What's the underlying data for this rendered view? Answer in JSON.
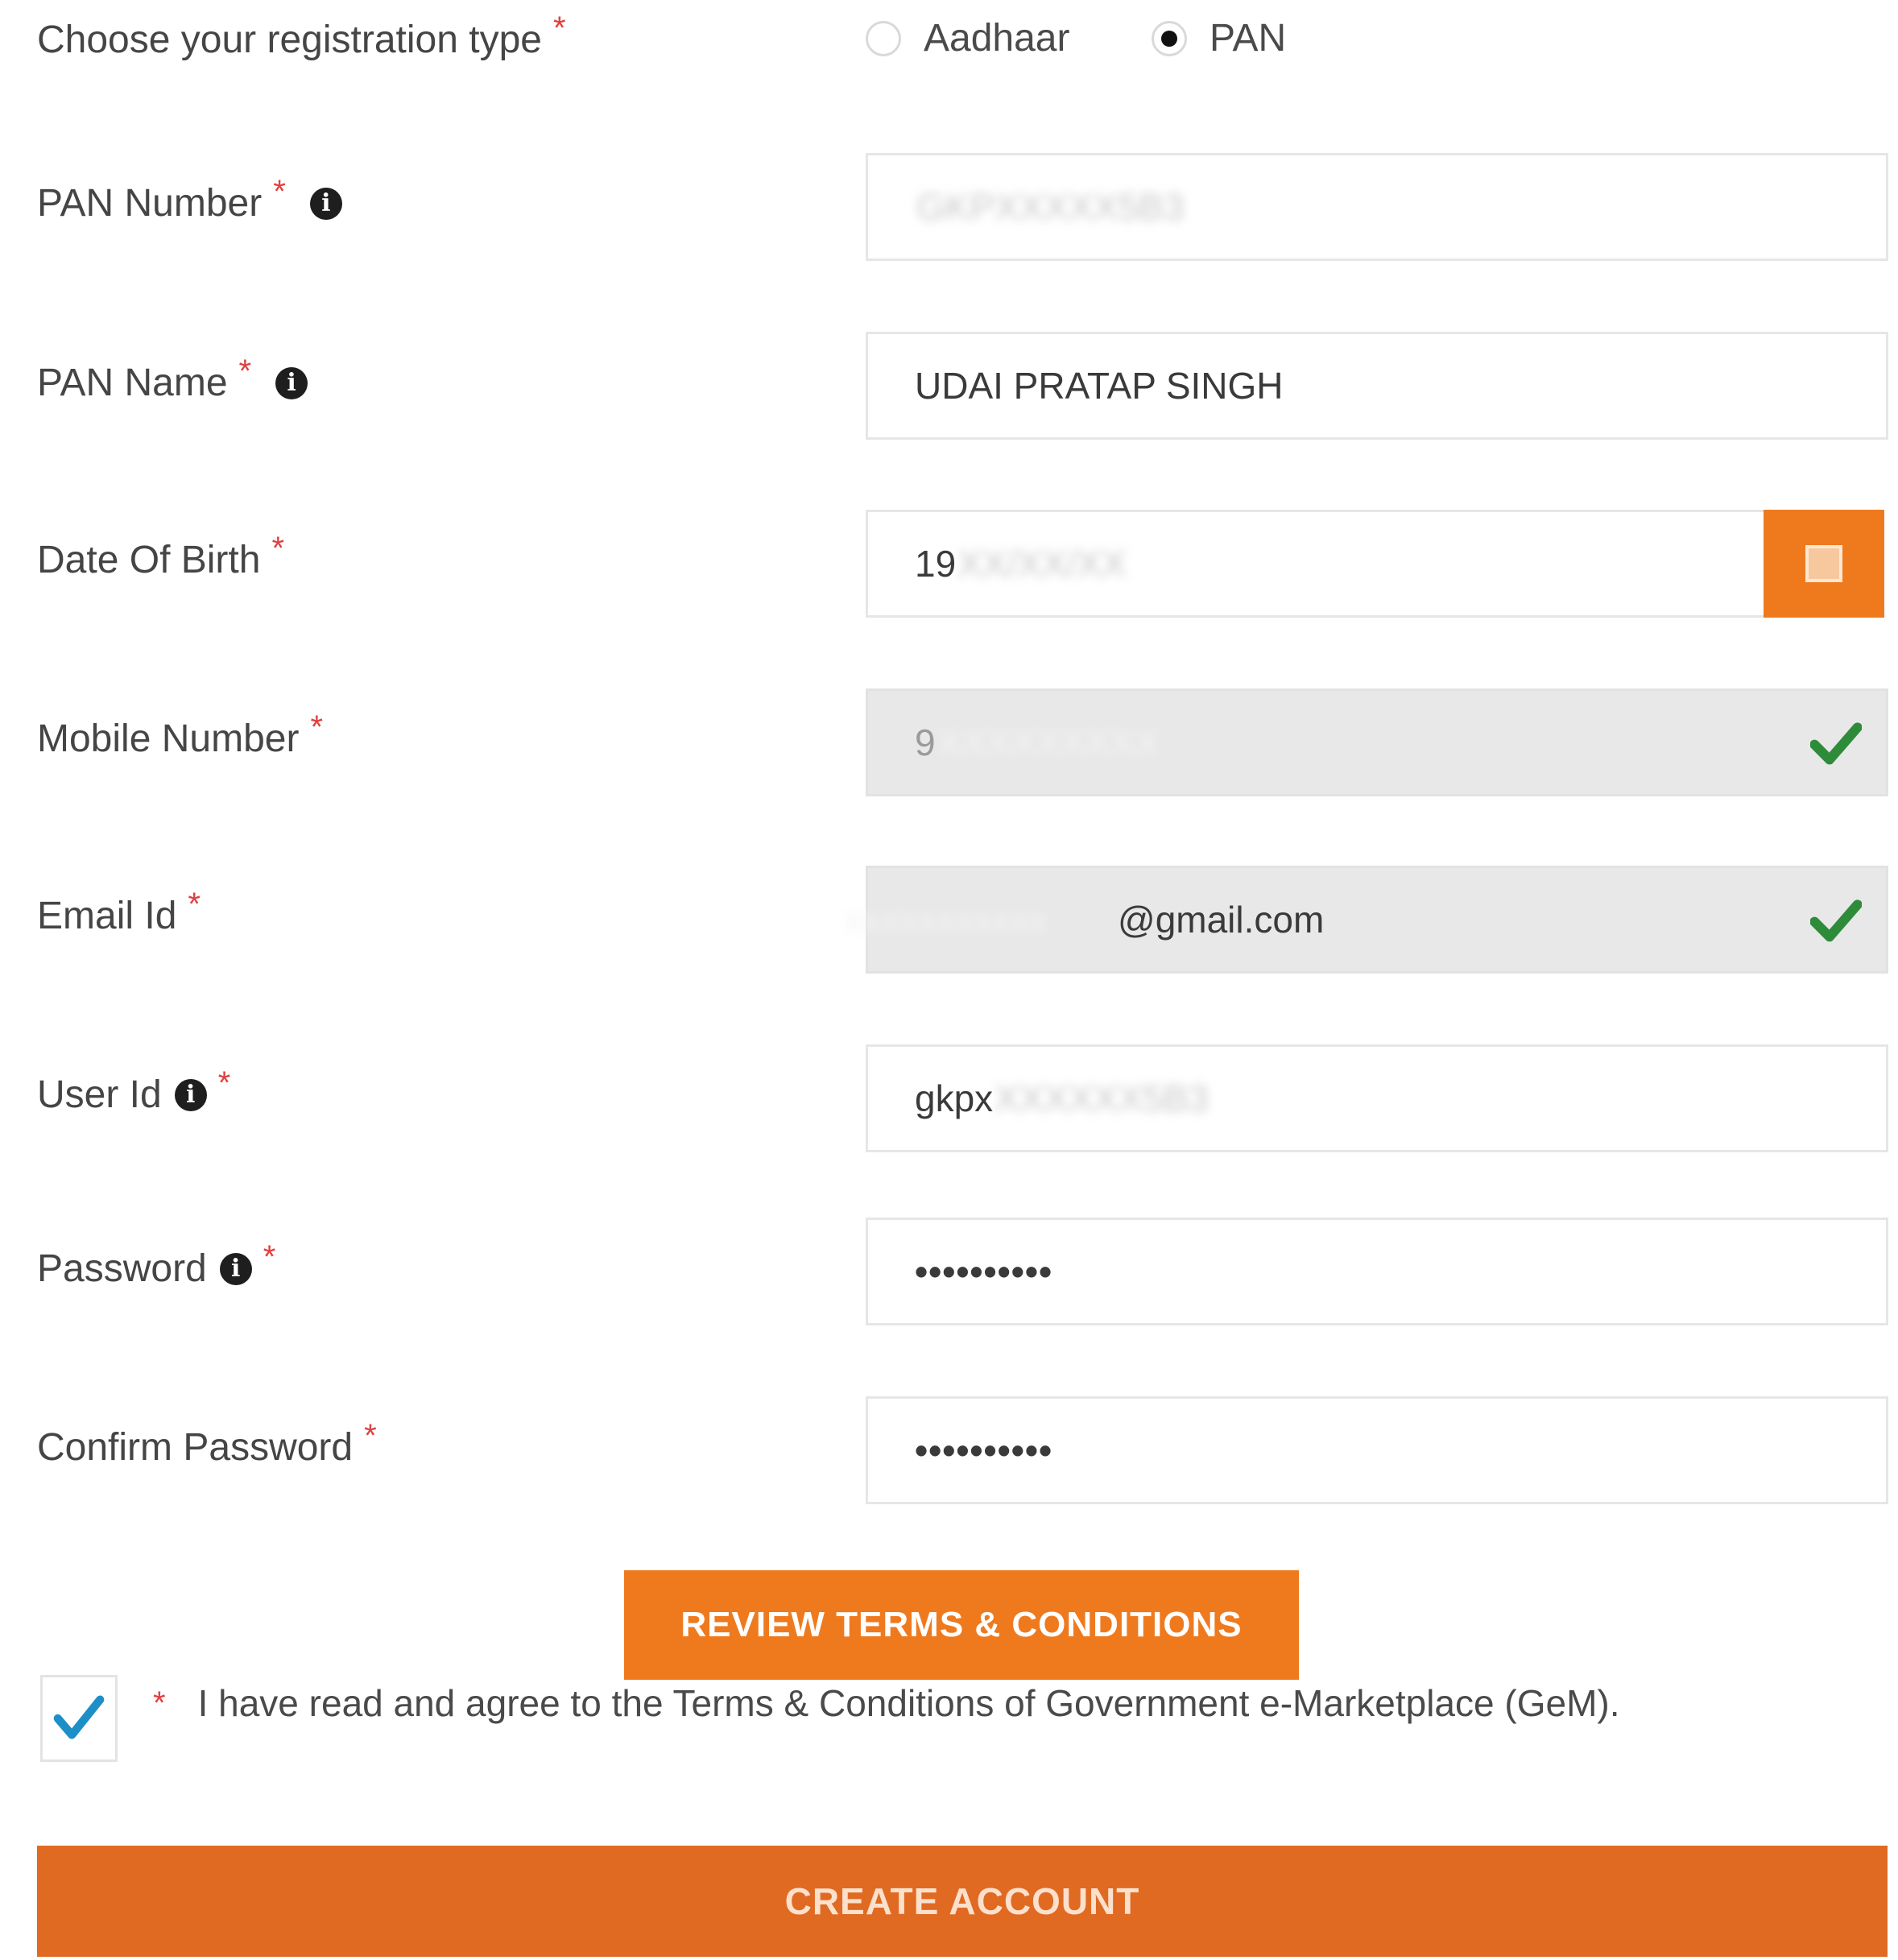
{
  "registration_type": {
    "label": "Choose your registration type",
    "required_mark": "*",
    "options": [
      {
        "label": "Aadhaar",
        "selected": false
      },
      {
        "label": "PAN",
        "selected": true
      }
    ]
  },
  "fields": {
    "pan_number": {
      "label": "PAN Number",
      "required_mark": "*",
      "value_visible": "",
      "value_masked": "GKPXXXXX5B3"
    },
    "pan_name": {
      "label": "PAN Name",
      "required_mark": "*",
      "value": "UDAI PRATAP SINGH"
    },
    "dob": {
      "label": "Date Of Birth",
      "required_mark": "*",
      "value_visible": "19",
      "value_masked": "XX/XX/XX"
    },
    "mobile": {
      "label": "Mobile Number",
      "required_mark": "*",
      "value_visible": "9",
      "value_masked": "XXXXXXXXX"
    },
    "email": {
      "label": "Email Id",
      "required_mark": "*",
      "value_masked": "xxxxxxxxxxx",
      "value_visible": "@gmail.com"
    },
    "user_id": {
      "label": "User Id",
      "required_mark": "*",
      "value_visible": "gkpx",
      "value_masked": "XXXXXX5B3"
    },
    "password": {
      "label": "Password",
      "required_mark": "*",
      "value": "••••••••••"
    },
    "confirm_password": {
      "label": "Confirm Password",
      "required_mark": "*",
      "value": "••••••••••"
    }
  },
  "buttons": {
    "review_terms": "REVIEW TERMS & CONDITIONS",
    "create_account": "CREATE ACCOUNT"
  },
  "agreement": {
    "required_mark": "*",
    "text": "I have read and agree to the Terms & Conditions of Government e-Marketplace (GeM).",
    "checked": true
  },
  "colors": {
    "accent": "#ef7a1e",
    "create_button": "#e06a22",
    "success_check": "#2e8b3a",
    "required": "#e04040"
  },
  "icons": {
    "info": "info-icon",
    "calendar": "calendar-icon",
    "verified": "check-icon"
  }
}
